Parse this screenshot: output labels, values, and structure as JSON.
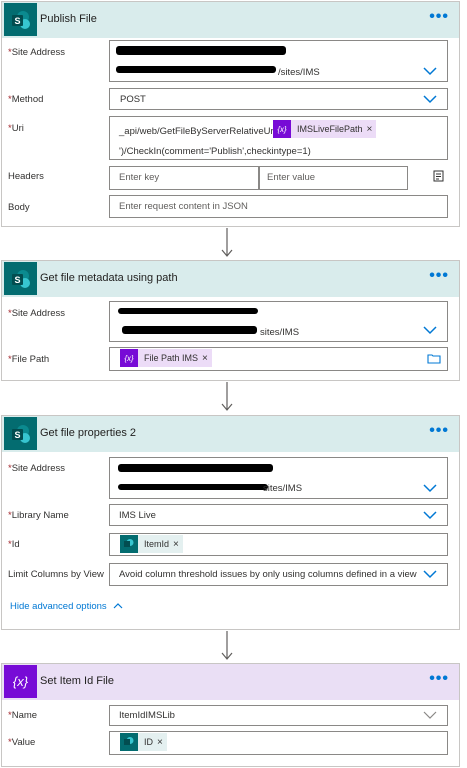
{
  "card1": {
    "title": "Publish File",
    "more": "•••",
    "site_label": "Site Address",
    "site_value_suffix": "/sites/IMS",
    "method_label": "Method",
    "method_value": "POST",
    "uri_label": "Uri",
    "uri_line1": "_api/web/GetFileByServerRelativeUrl('",
    "uri_token": "IMSLiveFilePath",
    "uri_line2": "')/CheckIn(comment='Publish',checkintype=1)",
    "headers_label": "Headers",
    "key_placeholder": "Enter key",
    "value_placeholder": "Enter value",
    "body_label": "Body",
    "body_placeholder": "Enter request content in JSON"
  },
  "card2": {
    "title": "Get file metadata using path",
    "more": "•••",
    "site_label": "Site Address",
    "site_value_suffix": "sites/IMS",
    "path_label": "File Path",
    "path_token": "File Path IMS"
  },
  "card3": {
    "title": "Get file properties 2",
    "more": "•••",
    "site_label": "Site Address",
    "site_value_suffix": "sites/IMS",
    "library_label": "Library Name",
    "library_value": "IMS Live",
    "id_label": "Id",
    "id_token": "ItemId",
    "limit_label": "Limit Columns by View",
    "limit_value": "Avoid column threshold issues by only using columns defined in a view",
    "advanced_link": "Hide advanced options"
  },
  "card4": {
    "title": "Set Item Id File",
    "more": "•••",
    "name_label": "Name",
    "name_value": "ItemIdIMSLib",
    "value_label": "Value",
    "value_token": "ID"
  },
  "common": {
    "required_mark": "*",
    "token_close": "×",
    "var_glyph": "{x}"
  },
  "colors": {
    "sharepoint": "#036c70",
    "variable": "#770bd6",
    "link": "#0078d4"
  },
  "icons": [
    "sharepoint-icon",
    "variable-icon",
    "chevron-down-icon",
    "chevron-up-icon",
    "folder-icon",
    "dynamic-content-icon",
    "arrow-down-icon",
    "more-icon"
  ]
}
